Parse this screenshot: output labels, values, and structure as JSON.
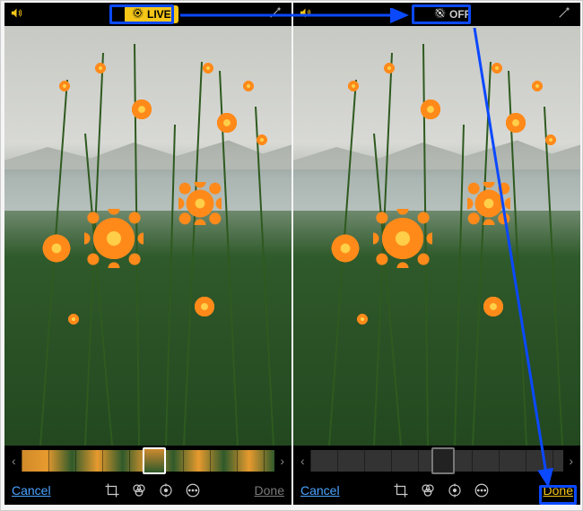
{
  "left": {
    "topbar": {
      "live_label": "LIVE"
    },
    "bottombar": {
      "cancel_label": "Cancel",
      "done_label": "Done"
    }
  },
  "right": {
    "topbar": {
      "off_label": "OFF"
    },
    "bottombar": {
      "cancel_label": "Cancel",
      "done_label": "Done"
    }
  },
  "icons": {
    "speaker": "speaker-icon",
    "live": "live-target-icon",
    "live_off": "live-target-off-icon",
    "wand": "magic-wand-icon",
    "crop": "crop-icon",
    "filters": "filters-icon",
    "adjust": "adjust-icon",
    "more": "more-icon",
    "chevron_left": "chevron-left-icon",
    "chevron_right": "chevron-right-icon"
  },
  "colors": {
    "accent_yellow": "#f5c518",
    "link_blue": "#4aa3ff",
    "highlight_blue": "#0b49ff"
  }
}
